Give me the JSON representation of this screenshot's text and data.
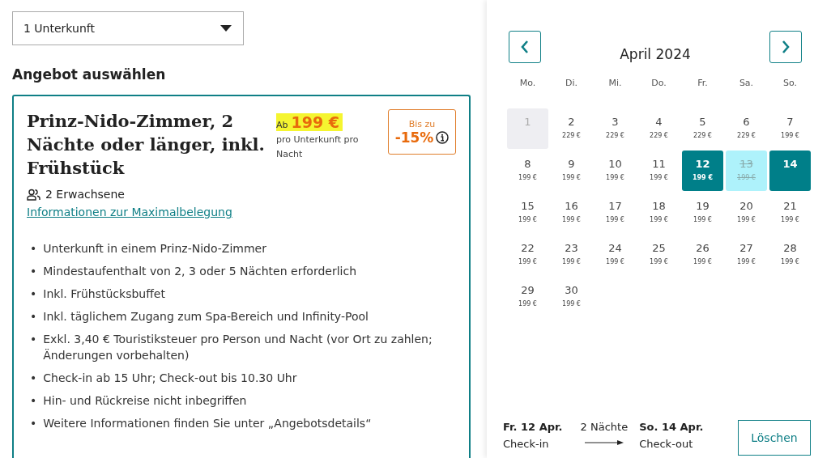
{
  "room_select": {
    "value": "1 Unterkunft"
  },
  "heading": "Angebot auswählen",
  "offer": {
    "title": "Prinz-Nido-Zimmer, 2 Nächte oder länger, inkl. Frühstück",
    "price_prefix": "Ab",
    "price": "199 €",
    "price_note": "pro Unterkunft pro Nacht",
    "discount_label": "Bis zu",
    "discount": "-15%",
    "guests": "2 Erwachsene",
    "occupancy_link": "Informationen zur Maximalbelegung",
    "bullet": "•",
    "features": [
      "Unterkunft in einem Prinz-Nido-Zimmer",
      "Mindestaufenthalt von 2, 3 oder 5 Nächten erforderlich",
      "Inkl. Frühstücksbuffet",
      "Inkl. täglichem Zugang zum Spa-Bereich und Infinity-Pool",
      "Exkl. 3,40 € Touristiksteuer pro Person und Nacht (vor Ort zu zahlen; Änderungen vorbehalten)",
      "Check-in ab 15 Uhr; Check-out bis 10.30 Uhr",
      "Hin- und Rückreise nicht inbegriffen",
      "Weitere Informationen finden Sie unter „Angebotsdetails“"
    ]
  },
  "calendar": {
    "month": "April 2024",
    "weekdays": [
      "Mo.",
      "Di.",
      "Mi.",
      "Do.",
      "Fr.",
      "Sa.",
      "So."
    ],
    "days": [
      {
        "day": "1",
        "kind": "unavailable"
      },
      {
        "day": "2",
        "price": "229 €",
        "kind": "normal"
      },
      {
        "day": "3",
        "price": "229 €",
        "kind": "normal"
      },
      {
        "day": "4",
        "price": "229 €",
        "kind": "normal"
      },
      {
        "day": "5",
        "price": "229 €",
        "kind": "normal"
      },
      {
        "day": "6",
        "price": "229 €",
        "kind": "normal"
      },
      {
        "day": "7",
        "price": "199 €",
        "kind": "normal"
      },
      {
        "day": "8",
        "price": "199 €",
        "kind": "normal"
      },
      {
        "day": "9",
        "price": "199 €",
        "kind": "normal"
      },
      {
        "day": "10",
        "price": "199 €",
        "kind": "normal"
      },
      {
        "day": "11",
        "price": "199 €",
        "kind": "normal"
      },
      {
        "day": "12",
        "price": "199 €",
        "kind": "checkin"
      },
      {
        "day": "13",
        "price": "199 €",
        "kind": "in_range"
      },
      {
        "day": "14",
        "kind": "checkout"
      },
      {
        "day": "15",
        "price": "199 €",
        "kind": "normal"
      },
      {
        "day": "16",
        "price": "199 €",
        "kind": "normal"
      },
      {
        "day": "17",
        "price": "199 €",
        "kind": "normal"
      },
      {
        "day": "18",
        "price": "199 €",
        "kind": "normal"
      },
      {
        "day": "19",
        "price": "199 €",
        "kind": "normal"
      },
      {
        "day": "20",
        "price": "199 €",
        "kind": "normal"
      },
      {
        "day": "21",
        "price": "199 €",
        "kind": "normal"
      },
      {
        "day": "22",
        "price": "199 €",
        "kind": "normal"
      },
      {
        "day": "23",
        "price": "199 €",
        "kind": "normal"
      },
      {
        "day": "24",
        "price": "199 €",
        "kind": "normal"
      },
      {
        "day": "25",
        "price": "199 €",
        "kind": "normal"
      },
      {
        "day": "26",
        "price": "199 €",
        "kind": "normal"
      },
      {
        "day": "27",
        "price": "199 €",
        "kind": "normal"
      },
      {
        "day": "28",
        "price": "199 €",
        "kind": "normal"
      },
      {
        "day": "29",
        "price": "199 €",
        "kind": "normal"
      },
      {
        "day": "30",
        "price": "199 €",
        "kind": "normal"
      }
    ]
  },
  "summary": {
    "checkin_date": "Fr. 12 Apr.",
    "checkin_label": "Check-in",
    "nights": "2 Nächte",
    "checkout_date": "So. 14 Apr.",
    "checkout_label": "Check-out",
    "clear_button": "Löschen"
  }
}
